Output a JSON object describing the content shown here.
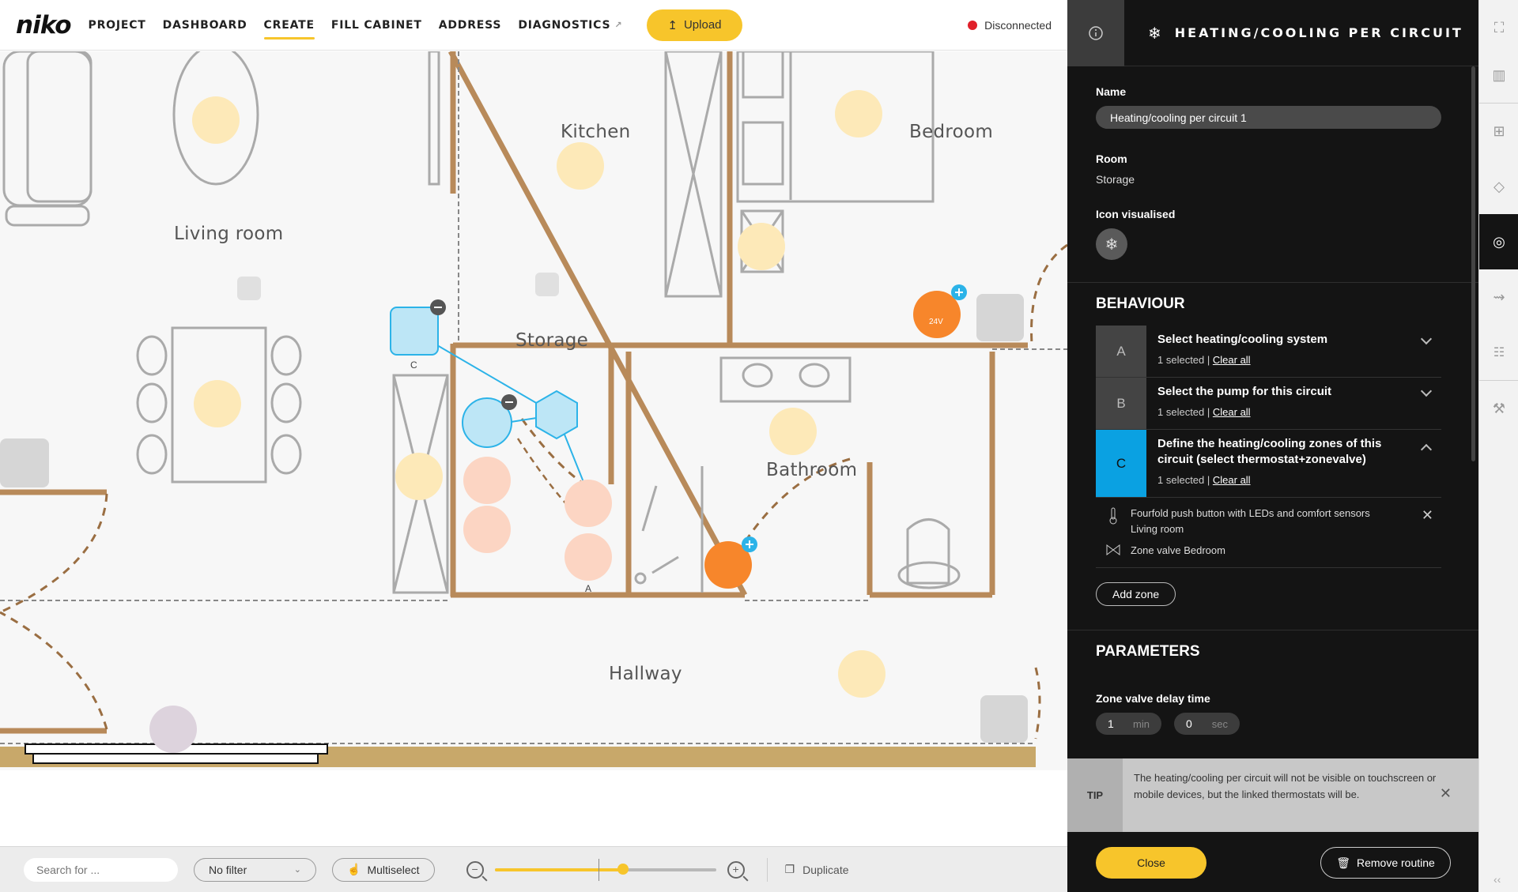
{
  "brand": "niko",
  "nav": [
    {
      "label": "PROJECT"
    },
    {
      "label": "DASHBOARD"
    },
    {
      "label": "CREATE",
      "active": true
    },
    {
      "label": "FILL CABINET"
    },
    {
      "label": "ADDRESS"
    },
    {
      "label": "DIAGNOSTICS",
      "external": true
    }
  ],
  "upload_label": "Upload",
  "connection": {
    "status": "Disconnected",
    "color": "#e0202a"
  },
  "rooms": {
    "living": "Living room",
    "kitchen": "Kitchen",
    "bedroom": "Bedroom",
    "storage": "Storage",
    "bathroom": "Bathroom",
    "hallway": "Hallway"
  },
  "device_letters": {
    "thermostat": "C",
    "pump": "A",
    "socket": "24V"
  },
  "bottom": {
    "search_placeholder": "Search for ...",
    "filter": "No filter",
    "multiselect": "Multiselect",
    "zoom_level": 0.58,
    "duplicate": "Duplicate"
  },
  "panel": {
    "title": "HEATING/COOLING PER CIRCUIT",
    "name_label": "Name",
    "name_value": "Heating/cooling per circuit 1",
    "room_label": "Room",
    "room_value": "Storage",
    "icon_label": "Icon visualised",
    "behaviour_title": "BEHAVIOUR",
    "behaviour": [
      {
        "letter": "A",
        "title": "Select heating/cooling system",
        "selected": "1 selected |",
        "clear": "Clear all",
        "expanded": false
      },
      {
        "letter": "B",
        "title": "Select the pump for this circuit",
        "selected": "1 selected |",
        "clear": "Clear all",
        "expanded": false
      },
      {
        "letter": "C",
        "title": "Define the heating/cooling zones of this circuit (select thermostat+zonevalve)",
        "selected": "1 selected |",
        "clear": "Clear all",
        "expanded": true
      }
    ],
    "zones": [
      {
        "line1": "Fourfold push button with LEDs and comfort sensors",
        "line2": "Living room"
      },
      {
        "line1": "Zone valve Bedroom",
        "line2": ""
      }
    ],
    "add_zone": "Add zone",
    "parameters_title": "PARAMETERS",
    "delay_label": "Zone valve delay time",
    "delay_min": "1",
    "delay_min_unit": "min",
    "delay_sec": "0",
    "delay_sec_unit": "sec",
    "tip_label": "TIP",
    "tip_text": "The heating/cooling per circuit will not be visible on touchscreen or mobile devices, but the linked thermostats will be.",
    "close": "Close",
    "remove": "Remove routine"
  },
  "colors": {
    "accent": "#f7c52b",
    "selection": "#0aa1e2",
    "device": "#f7862b",
    "wall": "#b88a5a"
  }
}
